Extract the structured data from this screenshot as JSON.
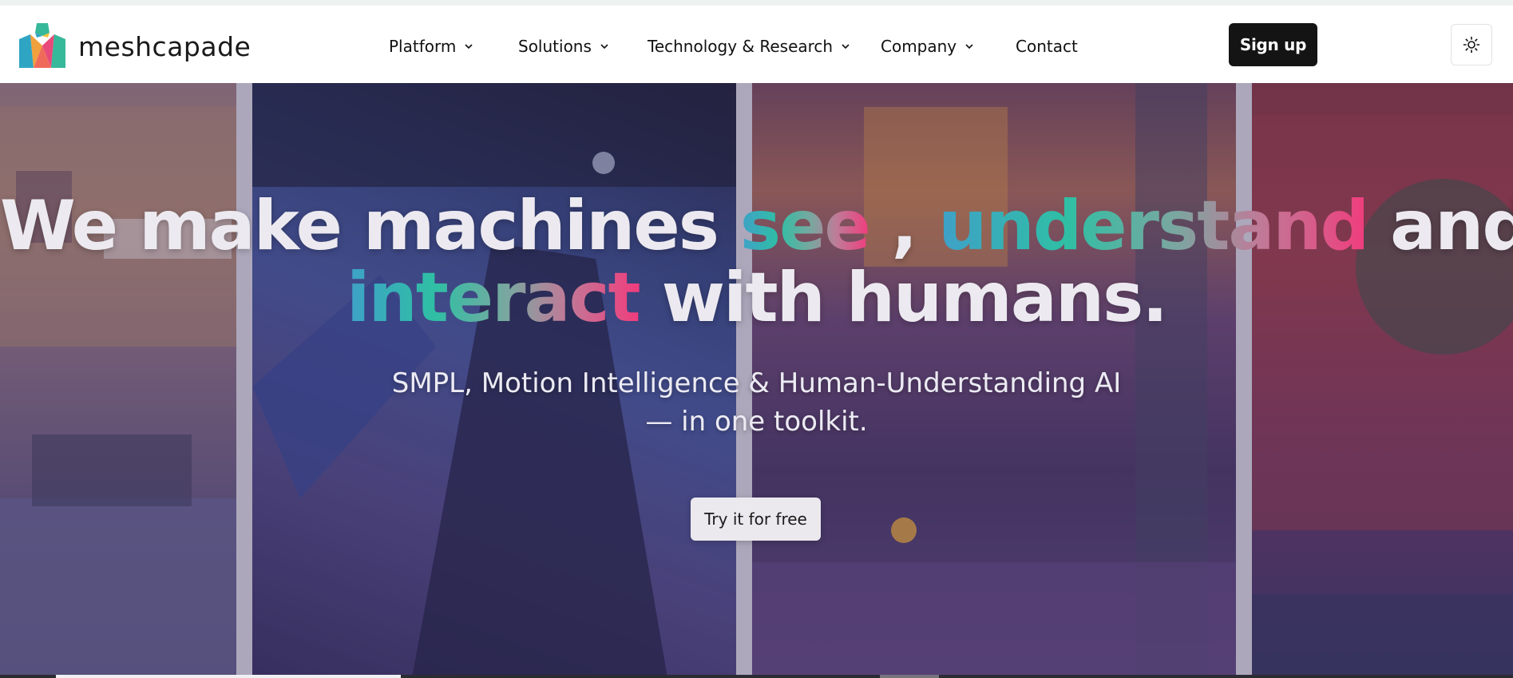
{
  "brand": {
    "name": "meshcapade",
    "colors": {
      "teal": "#2fbfa4",
      "blue": "#3fa0c8",
      "pink": "#f03c7c"
    }
  },
  "nav": {
    "items": [
      {
        "label": "Platform",
        "has_dropdown": true
      },
      {
        "label": "Solutions",
        "has_dropdown": true
      },
      {
        "label": "Technology & Research",
        "has_dropdown": true
      },
      {
        "label": "Company",
        "has_dropdown": true
      },
      {
        "label": "Contact",
        "has_dropdown": false
      }
    ],
    "signup_label": "Sign up",
    "theme_toggle_icon": "sun-icon"
  },
  "hero": {
    "headline": {
      "line1_plain_a": "We make machines ",
      "line1_grad_a": "see",
      "line1_plain_b": " , ",
      "line1_grad_b": "understand",
      "line1_plain_c": " and",
      "line2_grad": "interact",
      "line2_plain": " with humans."
    },
    "subheadline_line1": "SMPL, Motion Intelligence & Human-Understanding AI",
    "subheadline_line2": "— in one toolkit.",
    "cta_label": "Try it for free"
  }
}
